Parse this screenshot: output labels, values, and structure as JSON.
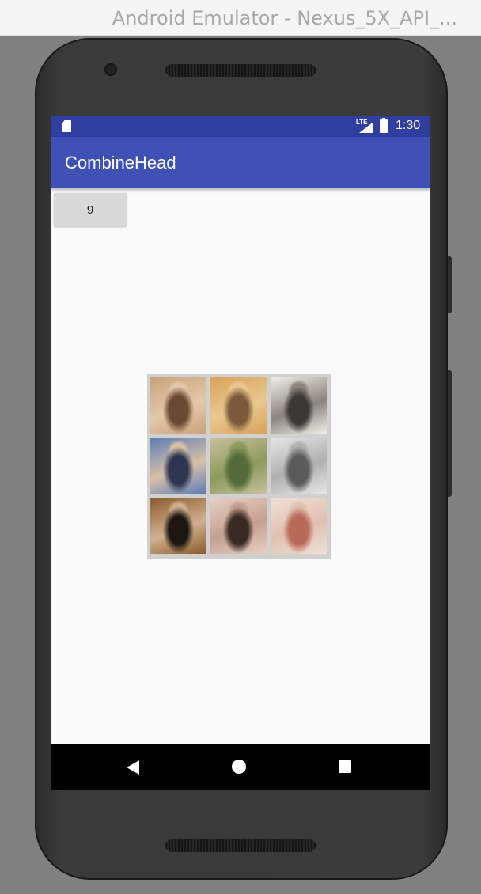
{
  "window": {
    "title": "Android Emulator - Nexus_5X_API_..."
  },
  "status_bar": {
    "network": "LTE",
    "time": "1:30"
  },
  "app_bar": {
    "title": "CombineHead"
  },
  "main": {
    "count_button_label": "9"
  },
  "combined_image": {
    "tiles": [
      {
        "name": "photo-1",
        "colors": [
          "#c9a27c",
          "#6b4a33",
          "#e3c8a8"
        ]
      },
      {
        "name": "photo-2",
        "colors": [
          "#d8a25a",
          "#7a5a3a",
          "#e8c890"
        ]
      },
      {
        "name": "photo-3",
        "colors": [
          "#f0eeea",
          "#3b3836",
          "#8a8480"
        ]
      },
      {
        "name": "photo-4",
        "colors": [
          "#5b7cb6",
          "#2d3550",
          "#d8c0a8"
        ]
      },
      {
        "name": "photo-5",
        "colors": [
          "#c8c0a0",
          "#556b3a",
          "#8c9a5a"
        ]
      },
      {
        "name": "photo-6",
        "colors": [
          "#e6e6e6",
          "#5a5a5a",
          "#b0b0b0"
        ]
      },
      {
        "name": "photo-7",
        "colors": [
          "#8a5a2a",
          "#1c1612",
          "#d0b090"
        ]
      },
      {
        "name": "photo-8",
        "colors": [
          "#e8d0c4",
          "#3a2a24",
          "#c4a090"
        ]
      },
      {
        "name": "photo-9",
        "colors": [
          "#f0e0d8",
          "#b86a5a",
          "#e0c0b0"
        ]
      }
    ]
  },
  "colors": {
    "status_bar": "#303f9f",
    "app_bar": "#3f51b5",
    "background": "#fafafa"
  }
}
